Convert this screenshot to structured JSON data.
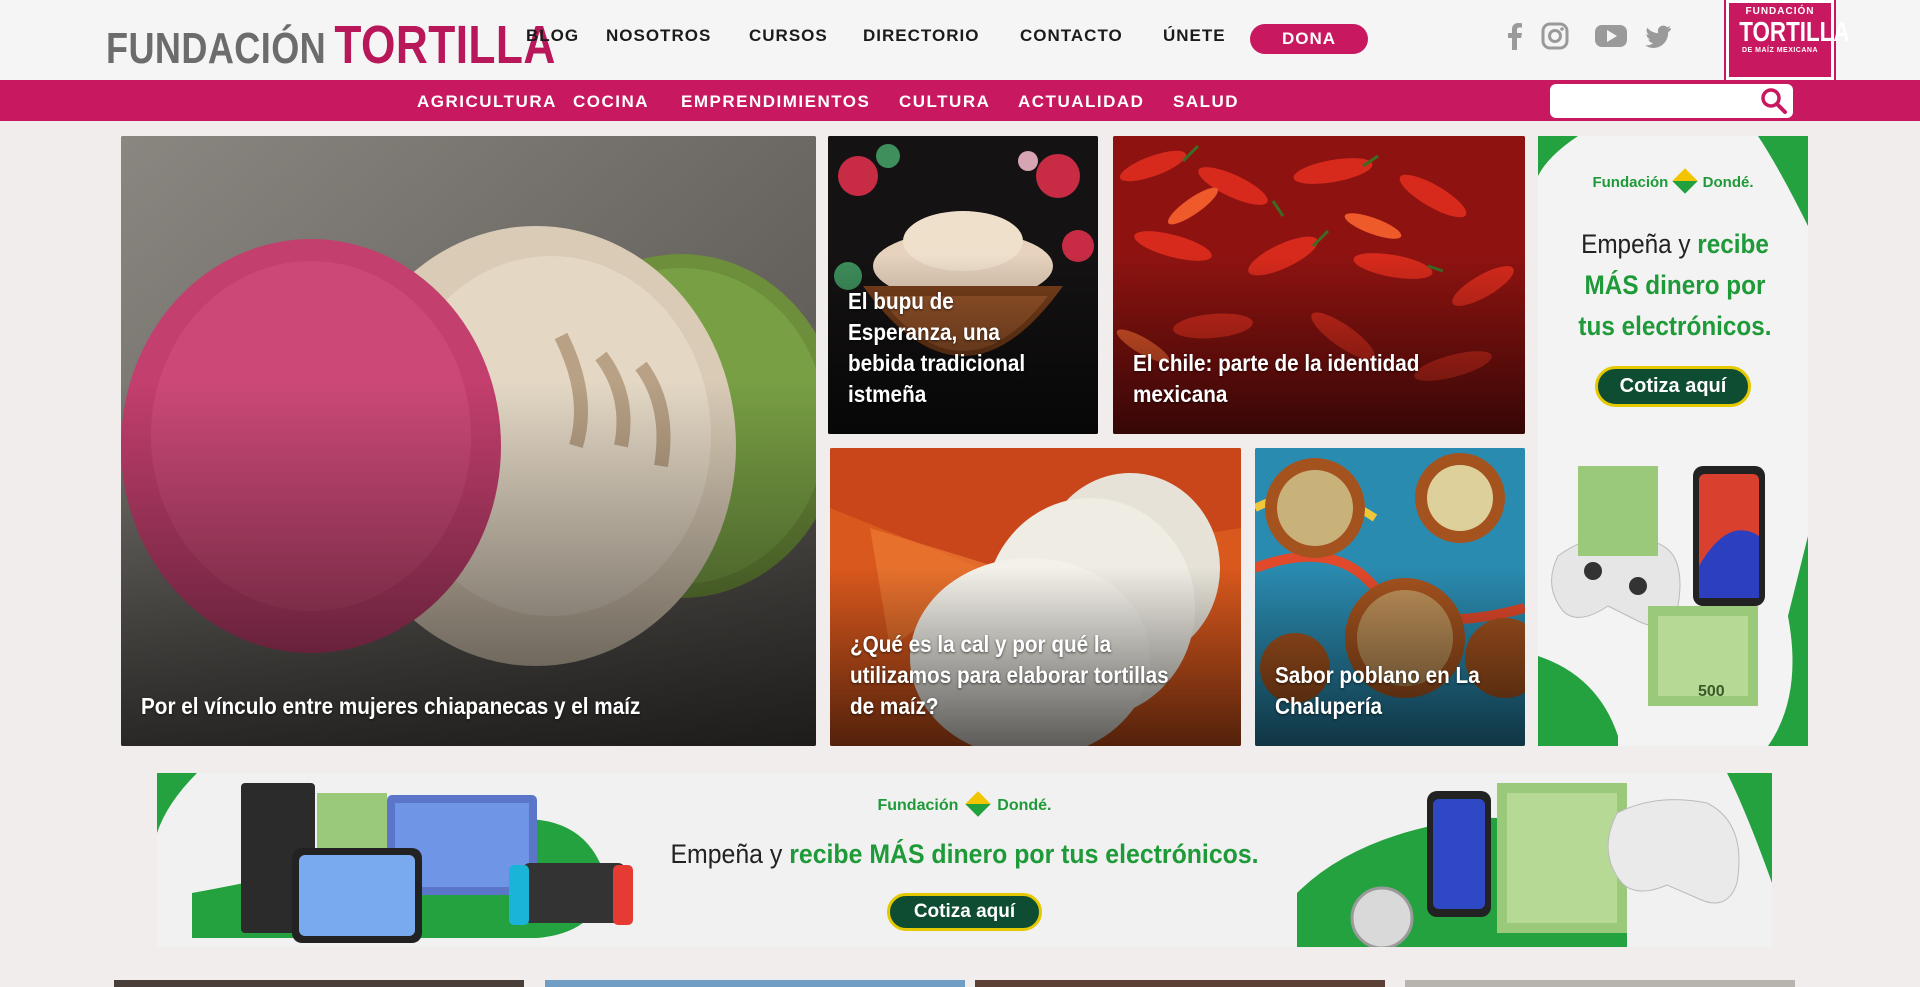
{
  "header": {
    "logo_part1": "FUNDACIÓN",
    "logo_part2": "TORTILLA",
    "nav": [
      "BLOG",
      "NOSOTROS",
      "CURSOS",
      "DIRECTORIO",
      "CONTACTO",
      "ÚNETE"
    ],
    "dona_label": "DONA",
    "social_icons": [
      "facebook-icon",
      "instagram-icon",
      "youtube-icon",
      "twitter-icon"
    ],
    "badge": {
      "line1": "FUNDACIÓN",
      "line2": "TORTILLA",
      "line3": "DE MAÍZ MEXICANA"
    }
  },
  "categories": [
    "AGRICULTURA",
    "COCINA",
    "EMPRENDIMIENTOS",
    "CULTURA",
    "ACTUALIDAD",
    "SALUD"
  ],
  "search": {
    "placeholder": "",
    "icon": "search-icon"
  },
  "articles": [
    {
      "title": "Por el vínculo entre mujeres chiapanecas y el maíz"
    },
    {
      "title": "El bupu de Esperanza, una bebida tradicional istmeña"
    },
    {
      "title": "El chile: parte de la identidad mexicana"
    },
    {
      "title": "¿Qué es la cal y por qué la utilizamos para elaborar tortillas de maíz?"
    },
    {
      "title": "Sabor poblano en La Chalupería"
    }
  ],
  "ad": {
    "brand_prefix": "Fundación",
    "brand_name": "Dondé.",
    "headline_plain": "Empeña y",
    "headline_green": "recibe MÁS dinero por tus electrónicos.",
    "cta": "Cotiza aquí",
    "bill_value": "500"
  },
  "colors": {
    "brand": "#c81860",
    "ad_green": "#1f9a39",
    "cta_dark": "#0f4d33"
  }
}
